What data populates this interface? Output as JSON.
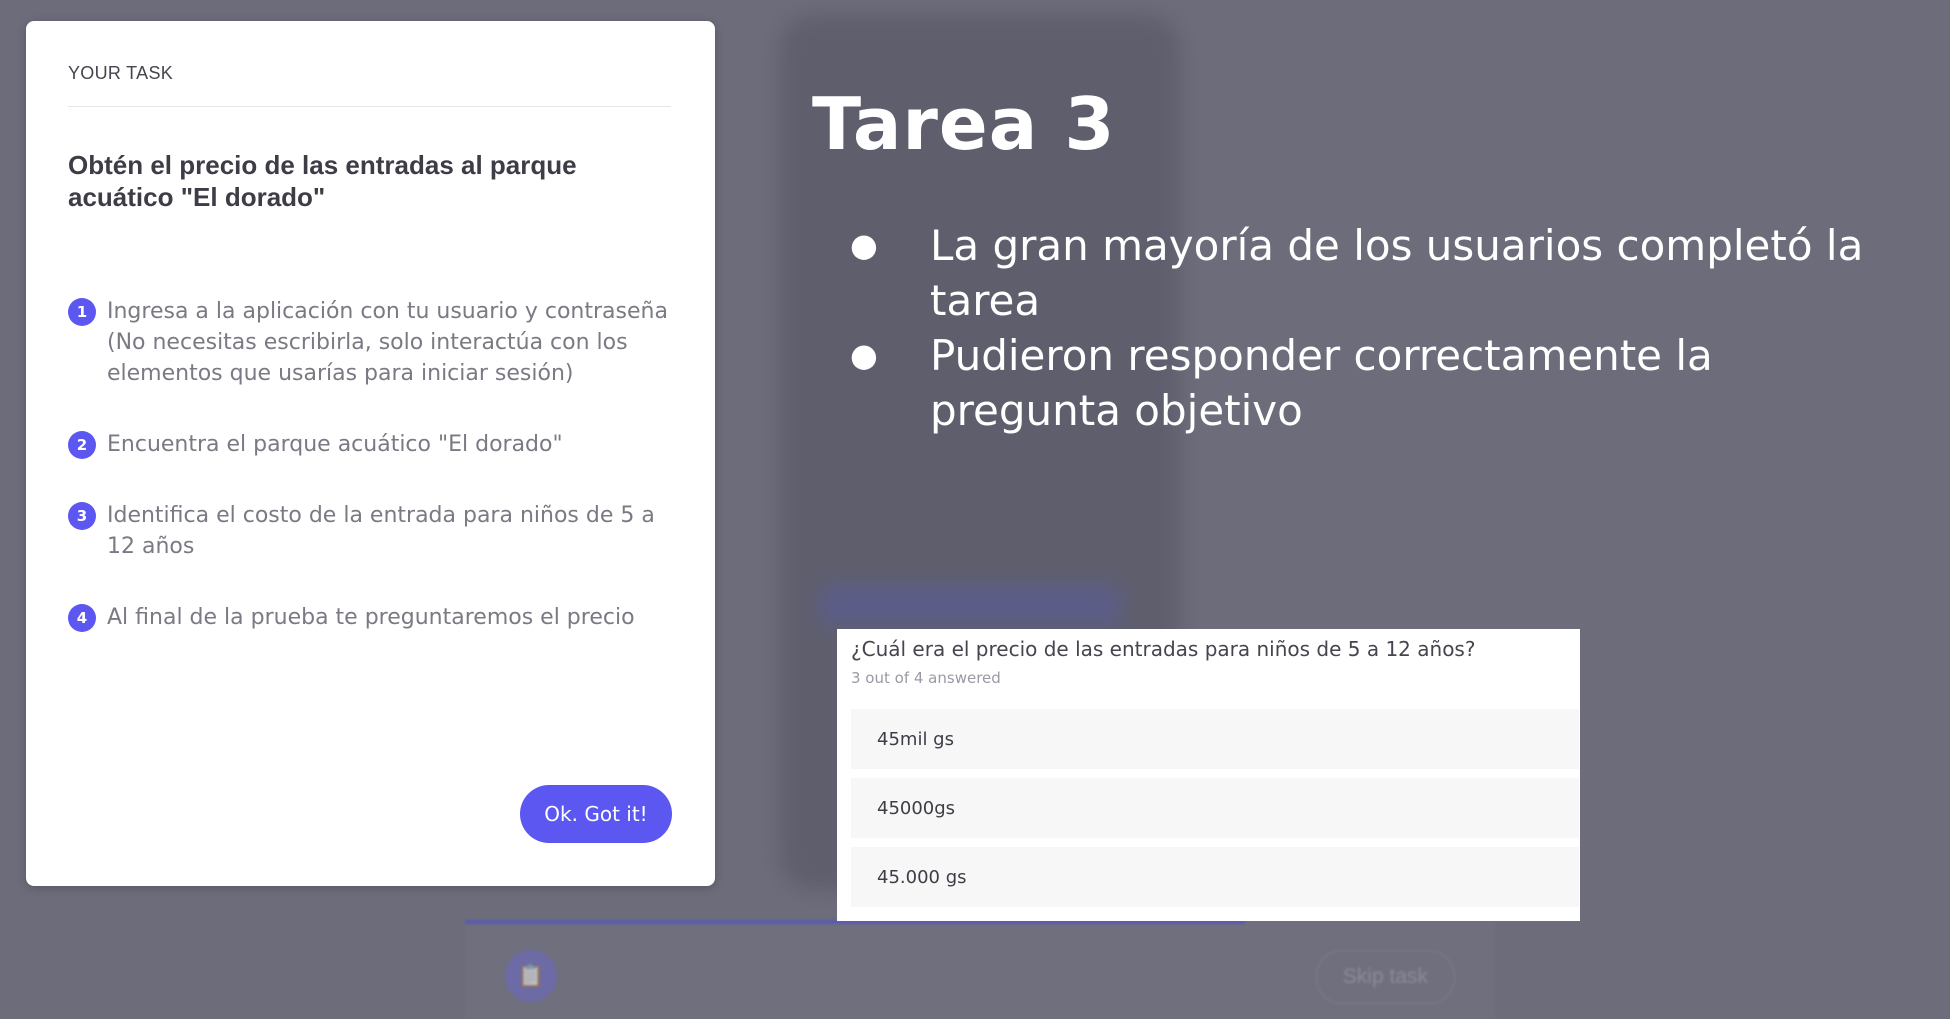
{
  "task_card": {
    "header": "YOUR TASK",
    "title": "Obtén el precio de las entradas al parque acuático \"El dorado\"",
    "steps": [
      {
        "number": "1",
        "text": "Ingresa a la aplicación con tu usuario y contraseña (No necesitas escribirla, solo interactúa con los elementos que usarías para iniciar sesión)"
      },
      {
        "number": "2",
        "text": "Encuentra el parque acuático \"El dorado\""
      },
      {
        "number": "3",
        "text": "Identifica el costo de la entrada para niños de 5 a 12 años"
      },
      {
        "number": "4",
        "text": "Al final de la prueba te preguntaremos el precio"
      }
    ],
    "ok_button_label": "Ok. Got it!"
  },
  "slide": {
    "title": "Tarea 3",
    "bullet_symbol": "●",
    "bullets": [
      "La gran mayoría de los usuarios completó la tarea",
      "Pudieron responder correctamente la pregunta objetivo"
    ]
  },
  "results": {
    "question": "¿Cuál era el precio de las entradas para niños de 5 a 12 años?",
    "meta": "3 out of 4 answered",
    "answers": [
      "45mil gs",
      "45000gs",
      "45.000 gs"
    ]
  },
  "toolbar": {
    "skip_label": "Skip task"
  },
  "colors": {
    "accent": "#5b57f0",
    "backdrop": "#6c6c7b",
    "card": "#ffffff"
  }
}
